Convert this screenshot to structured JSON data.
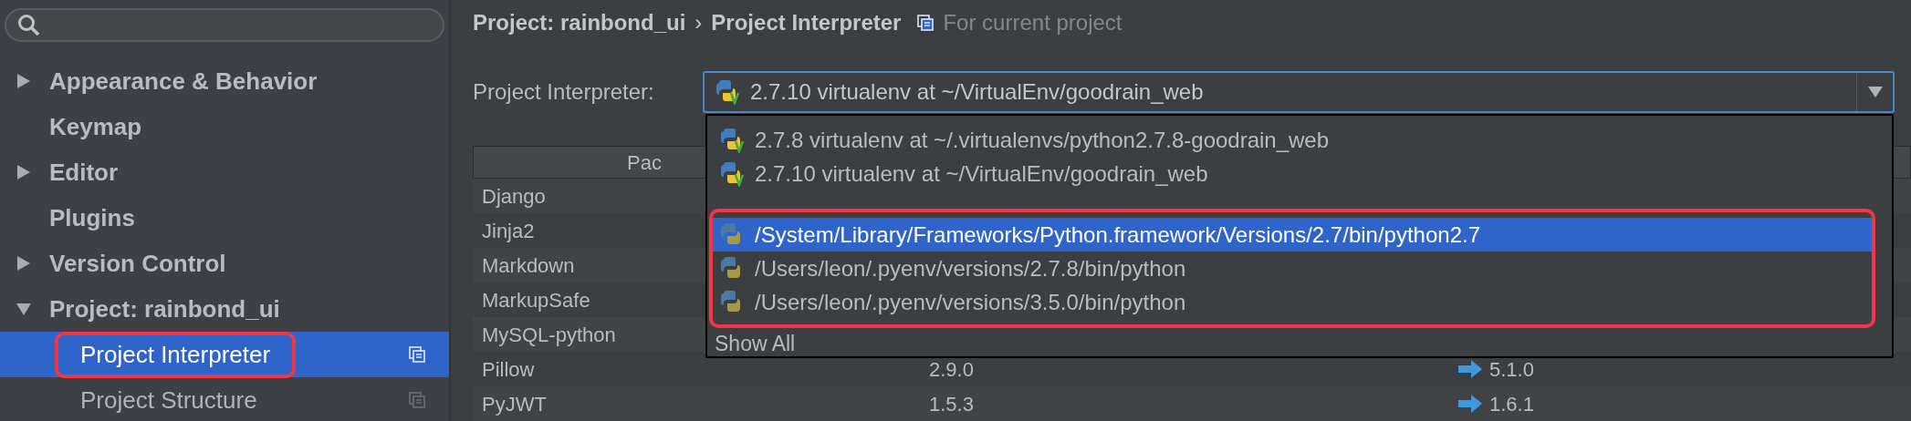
{
  "sidebar": {
    "items": [
      {
        "label": "Appearance & Behavior",
        "expanded": false
      },
      {
        "label": "Keymap"
      },
      {
        "label": "Editor",
        "expanded": false
      },
      {
        "label": "Plugins"
      },
      {
        "label": "Version Control",
        "expanded": false
      },
      {
        "label": "Project: rainbond_ui",
        "expanded": true,
        "children": [
          {
            "label": "Project Interpreter",
            "selected": true,
            "highlighted": true
          },
          {
            "label": "Project Structure",
            "selected": false,
            "highlighted": false
          }
        ]
      }
    ]
  },
  "breadcrumb": {
    "parent": "Project: rainbond_ui",
    "separator": "›",
    "current": "Project Interpreter",
    "scope": "For current project"
  },
  "interpreter": {
    "label": "Project Interpreter:",
    "value": "2.7.10 virtualenv at ~/VirtualEnv/goodrain_web",
    "kind": "virtualenv"
  },
  "dropdown": {
    "groups": [
      {
        "highlighted": false,
        "options": [
          {
            "label": "2.7.8 virtualenv at ~/.virtualenvs/python2.7.8-goodrain_web",
            "kind": "virtualenv",
            "selected": false
          },
          {
            "label": "2.7.10 virtualenv at ~/VirtualEnv/goodrain_web",
            "kind": "virtualenv",
            "selected": false
          }
        ]
      },
      {
        "highlighted": true,
        "options": [
          {
            "label": "/System/Library/Frameworks/Python.framework/Versions/2.7/bin/python2.7",
            "kind": "system",
            "selected": true
          },
          {
            "label": "/Users/leon/.pyenv/versions/2.7.8/bin/python",
            "kind": "system",
            "selected": false
          },
          {
            "label": "/Users/leon/.pyenv/versions/3.5.0/bin/python",
            "kind": "system",
            "selected": false
          }
        ]
      }
    ],
    "show_all": "Show All"
  },
  "table": {
    "header": "Pac",
    "rows": [
      {
        "package": "Django"
      },
      {
        "package": "Jinja2"
      },
      {
        "package": "Markdown"
      },
      {
        "package": "MarkupSafe"
      },
      {
        "package": "MySQL-python"
      },
      {
        "package": "Pillow",
        "version": "2.9.0",
        "latest": "5.1.0",
        "upgrade": true
      },
      {
        "package": "PyJWT",
        "version": "1.5.3",
        "latest": "1.6.1",
        "upgrade": true
      }
    ]
  }
}
